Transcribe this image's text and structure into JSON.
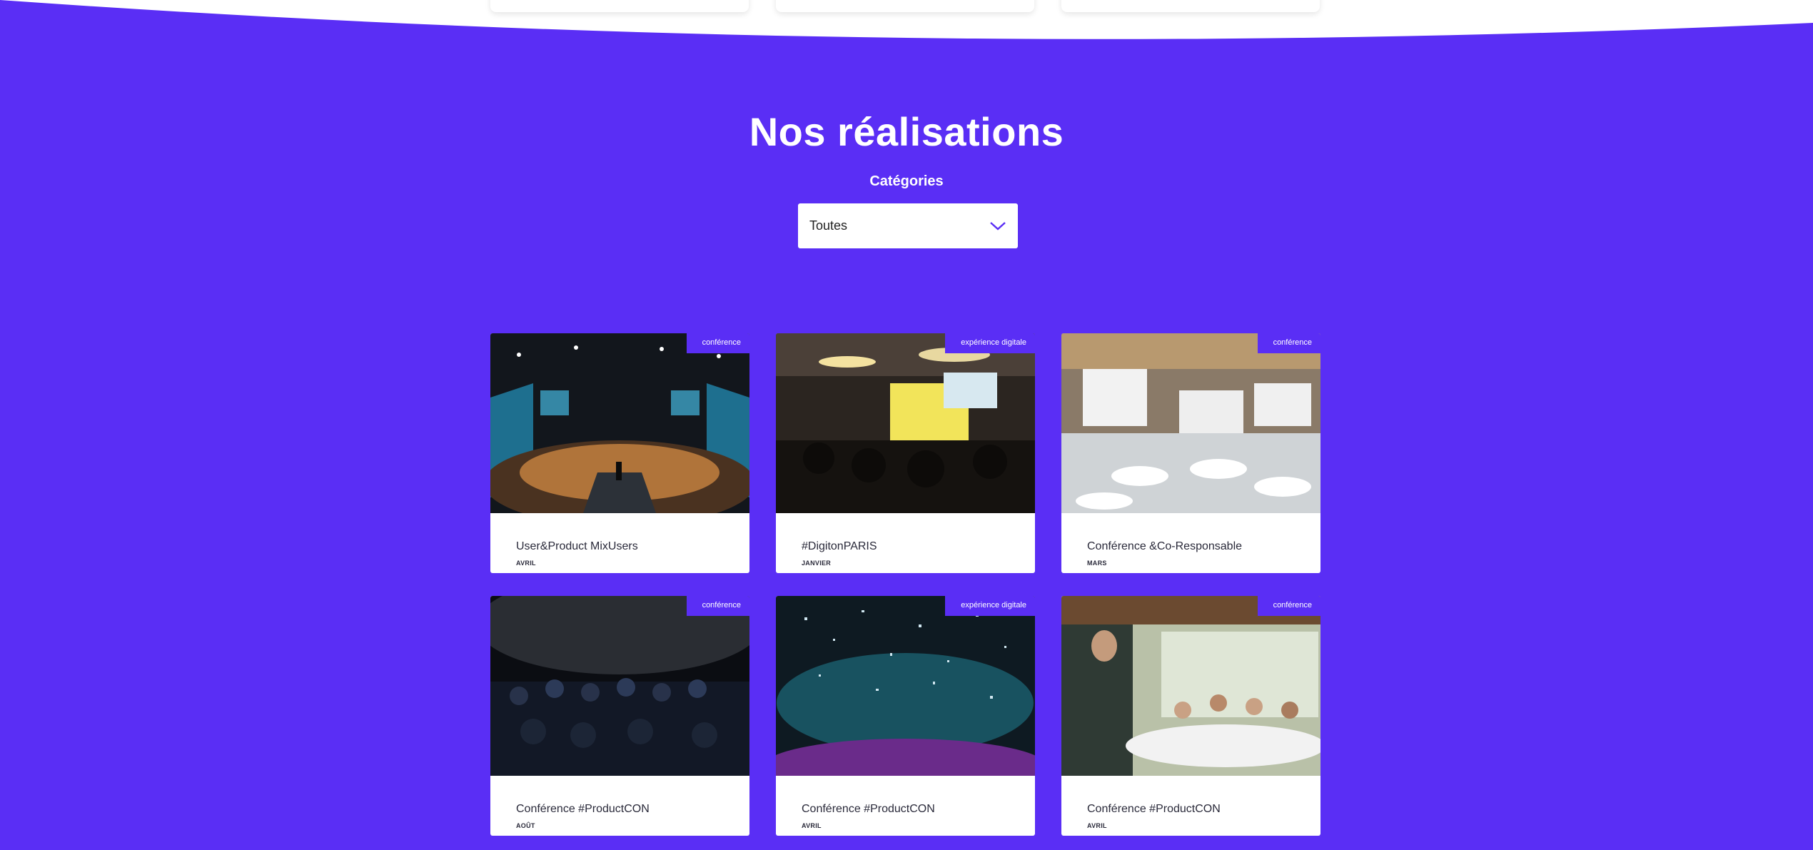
{
  "section": {
    "title": "Nos réalisations",
    "categories_label": "Catégories",
    "select": {
      "value": "Toutes",
      "icon": "chevron-down-icon"
    }
  },
  "colors": {
    "brand": "#5a2ef5",
    "card_bg": "#ffffff",
    "text": "#2a2a3a"
  },
  "projects": [
    {
      "badge": "conférence",
      "title": "User&Product MixUsers",
      "month": "AVRIL",
      "image": "conference-hall-photo"
    },
    {
      "badge": "expérience digitale",
      "title": "#DigitonPARIS",
      "month": "JANVIER",
      "image": "presentation-room-photo"
    },
    {
      "badge": "conférence",
      "title": "Conférence &Co-Responsable",
      "month": "MARS",
      "image": "auditorium-photo"
    },
    {
      "badge": "conférence",
      "title": "Conférence #ProductCON",
      "month": "AOÛT",
      "image": "audience-photo"
    },
    {
      "badge": "expérience digitale",
      "title": "Conférence #ProductCON",
      "month": "AVRIL",
      "image": "confetti-concert-photo"
    },
    {
      "badge": "conférence",
      "title": "Conférence #ProductCON",
      "month": "AVRIL",
      "image": "dinner-talk-photo"
    }
  ]
}
